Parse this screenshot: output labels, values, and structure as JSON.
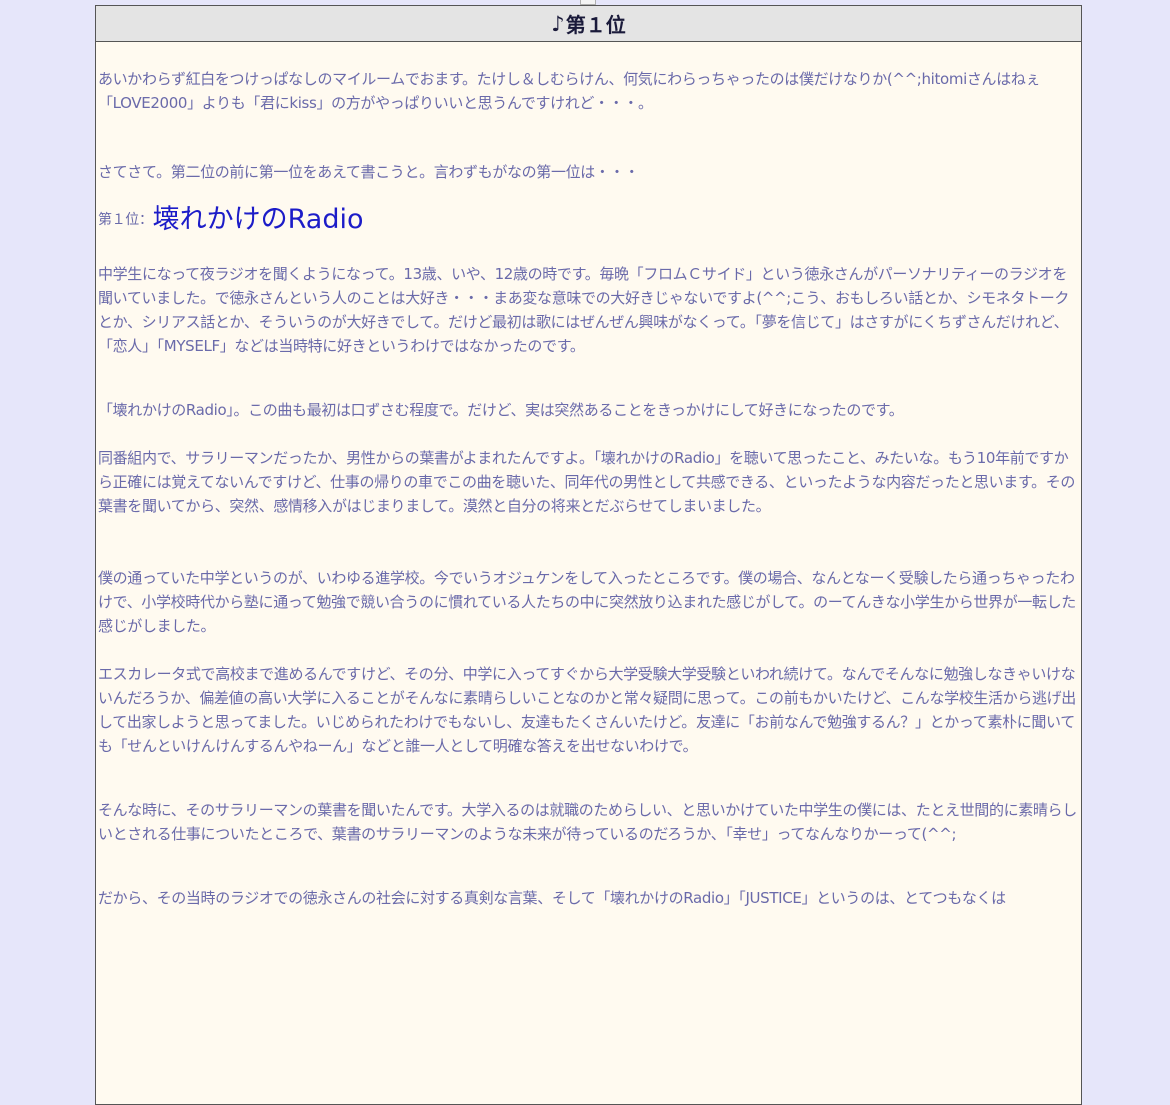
{
  "header": {
    "note_symbol": "♪",
    "title": "第１位"
  },
  "colors": {
    "page_background": "#e6e6fa",
    "panel_background": "#fffaf0",
    "header_background": "#e4e4e4",
    "body_text": "#6a6aaa",
    "rank_title_text": "#1c1cc8"
  },
  "content": {
    "intro": "あいかわらず紅白をつけっぱなしのマイルームでおます。たけし＆しむらけん、何気にわらっちゃったのは僕だけなりか(^^;hitomiさんはねぇ「LOVE2000」よりも「君にkiss」の方がやっぱりいいと思うんですけれど・・・。",
    "lead": "さてさて。第二位の前に第一位をあえて書こうと。言わずもがなの第一位は・・・",
    "rank_prefix": "第１位：",
    "rank_title": "壊れかけのRadio",
    "paragraphs": [
      "中学生になって夜ラジオを聞くようになって。13歳、いや、12歳の時です。毎晩「フロムＣサイド」という徳永さんがパーソナリティーのラジオを聞いていました。で徳永さんという人のことは大好き・・・まあ変な意味での大好きじゃないですよ(^^;こう、おもしろい話とか、シモネタトークとか、シリアス話とか、そういうのが大好きでして。だけど最初は歌にはぜんぜん興味がなくって。「夢を信じて」はさすがにくちずさんだけれど、「恋人」「MYSELF」などは当時特に好きというわけではなかったのです。",
      "「壊れかけのRadio」。この曲も最初は口ずさむ程度で。だけど、実は突然あることをきっかけにして好きになったのです。",
      "同番組内で、サラリーマンだったか、男性からの葉書がよまれたんですよ。「壊れかけのRadio」を聴いて思ったこと、みたいな。もう10年前ですから正確には覚えてないんですけど、仕事の帰りの車でこの曲を聴いた、同年代の男性として共感できる、といったような内容だったと思います。その葉書を聞いてから、突然、感情移入がはじまりまして。漠然と自分の将来とだぶらせてしまいました。",
      "僕の通っていた中学というのが、いわゆる進学校。今でいうオジュケンをして入ったところです。僕の場合、なんとなーく受験したら通っちゃったわけで、小学校時代から塾に通って勉強で競い合うのに慣れている人たちの中に突然放り込まれた感じがして。のーてんきな小学生から世界が一転した感じがしました。",
      "エスカレータ式で高校まで進めるんですけど、その分、中学に入ってすぐから大学受験大学受験といわれ続けて。なんでそんなに勉強しなきゃいけないんだろうか、偏差値の高い大学に入ることがそんなに素晴らしいことなのかと常々疑問に思って。この前もかいたけど、こんな学校生活から逃げ出して出家しようと思ってました。いじめられたわけでもないし、友達もたくさんいたけど。友達に「お前なんで勉強するん？」とかって素朴に聞いても「せんといけんけんするんやねーん」などと誰一人として明確な答えを出せないわけで。",
      "そんな時に、そのサラリーマンの葉書を聞いたんです。大学入るのは就職のためらしい、と思いかけていた中学生の僕には、たとえ世間的に素晴らしいとされる仕事についたところで、葉書のサラリーマンのような未来が待っているのだろうか、「幸せ」ってなんなりかーって(^^;",
      "だから、その当時のラジオでの徳永さんの社会に対する真剣な言葉、そして「壊れかけのRadio」「JUSTICE」というのは、とてつもなくは"
    ]
  }
}
